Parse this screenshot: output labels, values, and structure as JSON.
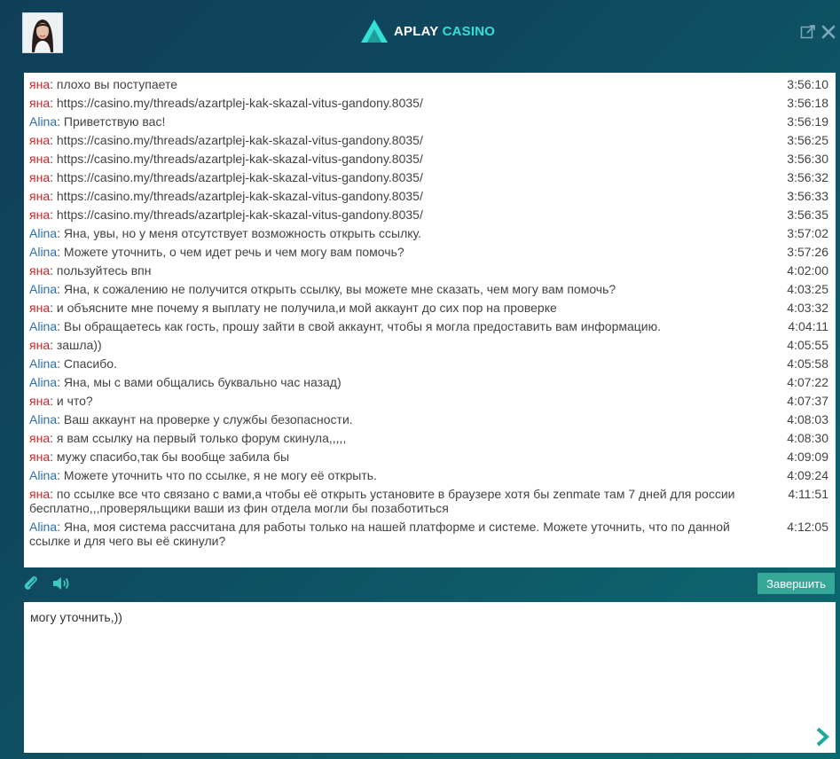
{
  "header": {
    "brand_part1": "APLAY",
    "brand_part2": "CASINO"
  },
  "chat": {
    "messages": [
      {
        "author": "яна",
        "role": "user",
        "text": "плохо вы поступаете",
        "time": "3:56:10"
      },
      {
        "author": "яна",
        "role": "user",
        "text": "https://casino.my/threads/azartplej-kak-skazal-vitus-gandony.8035/",
        "time": "3:56:18"
      },
      {
        "author": "Alina",
        "role": "agent",
        "text": "Приветствую вас!",
        "time": "3:56:19"
      },
      {
        "author": "яна",
        "role": "user",
        "text": "https://casino.my/threads/azartplej-kak-skazal-vitus-gandony.8035/",
        "time": "3:56:25"
      },
      {
        "author": "яна",
        "role": "user",
        "text": "https://casino.my/threads/azartplej-kak-skazal-vitus-gandony.8035/",
        "time": "3:56:30"
      },
      {
        "author": "яна",
        "role": "user",
        "text": "https://casino.my/threads/azartplej-kak-skazal-vitus-gandony.8035/",
        "time": "3:56:32"
      },
      {
        "author": "яна",
        "role": "user",
        "text": "https://casino.my/threads/azartplej-kak-skazal-vitus-gandony.8035/",
        "time": "3:56:33"
      },
      {
        "author": "яна",
        "role": "user",
        "text": "https://casino.my/threads/azartplej-kak-skazal-vitus-gandony.8035/",
        "time": "3:56:35"
      },
      {
        "author": "Alina",
        "role": "agent",
        "text": "Яна, увы, но у меня отсутствует возможность открыть ссылку.",
        "time": "3:57:02"
      },
      {
        "author": "Alina",
        "role": "agent",
        "text": "Можете уточнить, о чем идет речь и чем могу вам помочь?",
        "time": "3:57:26"
      },
      {
        "author": "яна",
        "role": "user",
        "text": "пользуйтесь впн",
        "time": "4:02:00"
      },
      {
        "author": "Alina",
        "role": "agent",
        "text": "Яна, к сожалению не получится открыть ссылку, вы можете мне сказать, чем могу вам помочь?",
        "time": "4:03:25"
      },
      {
        "author": "яна",
        "role": "user",
        "text": "и объясните мне почему я выплату не получила,и мой аккаунт до сих пор на проверке",
        "time": "4:03:32"
      },
      {
        "author": "Alina",
        "role": "agent",
        "text": "Вы обращаетесь как гость, прошу зайти в свой аккаунт, чтобы я могла предоставить вам информацию.",
        "time": "4:04:11"
      },
      {
        "author": "яна",
        "role": "user",
        "text": "зашла))",
        "time": "4:05:55"
      },
      {
        "author": "Alina",
        "role": "agent",
        "text": "Спасибо.",
        "time": "4:05:58"
      },
      {
        "author": "Alina",
        "role": "agent",
        "text": "Яна, мы с вами общались буквально час назад)",
        "time": "4:07:22"
      },
      {
        "author": "яна",
        "role": "user",
        "text": "и что?",
        "time": "4:07:37"
      },
      {
        "author": "Alina",
        "role": "agent",
        "text": "Ваш аккаунт на проверке у службы безопасности.",
        "time": "4:08:03"
      },
      {
        "author": "яна",
        "role": "user",
        "text": "я вам ссылку на первый только форум скинула,,,,,",
        "time": "4:08:30"
      },
      {
        "author": "яна",
        "role": "user",
        "text": "мужу спасибо,так бы вообще забила бы",
        "time": "4:09:09"
      },
      {
        "author": "Alina",
        "role": "agent",
        "text": "Можете уточнить что по ссылке, я не могу её открыть.",
        "time": "4:09:24"
      },
      {
        "author": "яна",
        "role": "user",
        "text": "по ссылке все что связано с вами,а чтобы её открыть установите в браузере хотя бы zenmate там 7 дней для россии бесплатно,,,проверяльщики ваши из фин отдела могли бы позаботиться",
        "time": "4:11:51"
      },
      {
        "author": "Alina",
        "role": "agent",
        "text": "Яна, моя система рассчитана для работы только на нашей платформе и системе. Можете уточнить, что по данной ссылке и для чего вы её скинули?",
        "time": "4:12:05"
      }
    ]
  },
  "toolbar": {
    "finish_label": "Завершить"
  },
  "input": {
    "value": "могу уточнить,))"
  },
  "colors": {
    "user_name": "#c62828",
    "agent_name": "#2c6fb0",
    "finish_button": "#36a898",
    "accent": "#33e0d6"
  },
  "icons": {
    "avatar": "agent-avatar",
    "logo": "aplay-logo-icon",
    "popout": "popout-icon",
    "close": "close-icon",
    "attach": "paperclip-icon",
    "sound": "speaker-icon",
    "send": "chevron-right-icon"
  }
}
